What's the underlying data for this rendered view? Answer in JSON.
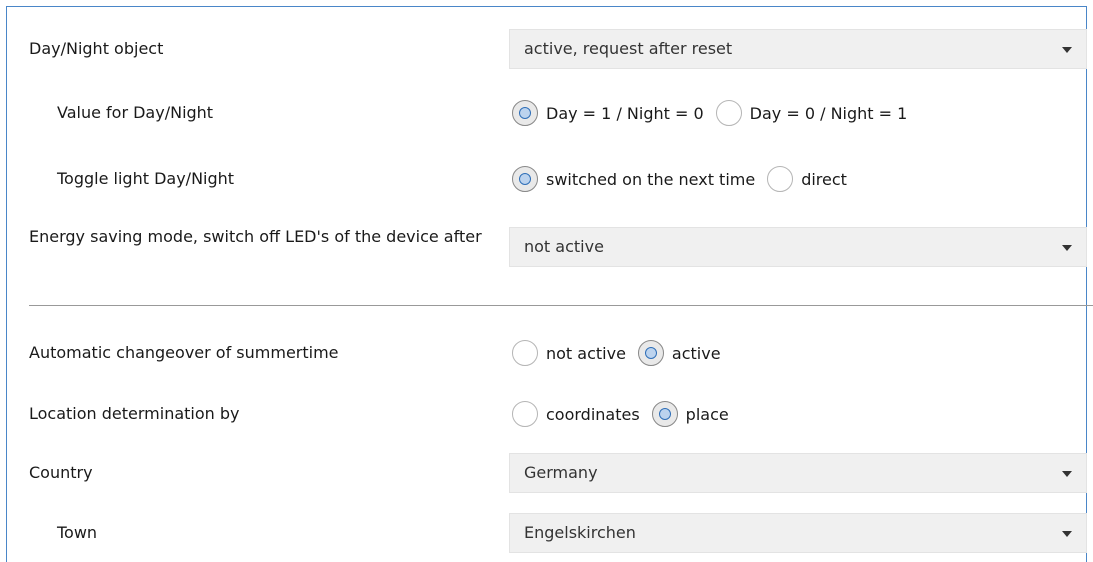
{
  "dayNight": {
    "label": "Day/Night object",
    "value": "active, request after reset"
  },
  "valueDayNight": {
    "label": "Value for Day/Night",
    "options": [
      "Day = 1 / Night = 0",
      "Day = 0 / Night = 1"
    ],
    "selected": 0
  },
  "toggleLight": {
    "label": "Toggle light Day/Night",
    "options": [
      "switched on the next time",
      "direct"
    ],
    "selected": 0
  },
  "energySaving": {
    "label": "Energy saving mode, switch off LED's of the device after",
    "value": "not active"
  },
  "summertime": {
    "label": "Automatic changeover of summertime",
    "options": [
      "not active",
      "active"
    ],
    "selected": 1
  },
  "location": {
    "label": "Location determination by",
    "options": [
      "coordinates",
      "place"
    ],
    "selected": 1
  },
  "country": {
    "label": "Country",
    "value": "Germany"
  },
  "town": {
    "label": "Town",
    "value": "Engelskirchen"
  }
}
